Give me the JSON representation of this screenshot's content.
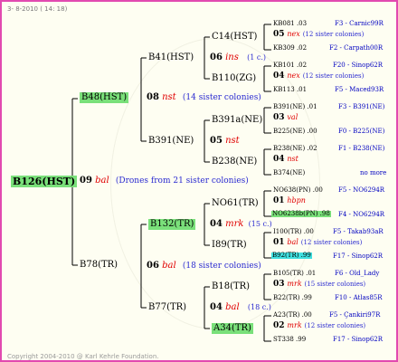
{
  "header": "3-  8-2010  ( 14: 18)",
  "footer": "Copyright 2004-2010 @ Karl Kehrle Foundation.",
  "gen1": {
    "name": "B126(HST)",
    "year": "09",
    "queen": "bal",
    "note": "(Drones from 21 sister colonies)"
  },
  "gen2a": {
    "name": "B48(HST)",
    "year": "08",
    "queen": "nst",
    "note": "(14 sister colonies)"
  },
  "gen2b": {
    "name": "B78(TR)",
    "year": "06",
    "queen": "bal",
    "note": "(18 sister colonies)"
  },
  "gen3": [
    {
      "name": "B41(HST)",
      "year": "06",
      "queen": "ins",
      "note": "(1 c.)"
    },
    {
      "name": "B391(NE)",
      "year": "05",
      "queen": "nst",
      "note": ""
    },
    {
      "name": "B132(TR)",
      "year": "04",
      "queen": "mrk",
      "note": "(15 c.)"
    },
    {
      "name": "B77(TR)",
      "year": "04",
      "queen": "bal",
      "note": "(18 c.)"
    }
  ],
  "gen4": [
    {
      "name": "C14(HST)"
    },
    {
      "name": "B110(ZG)"
    },
    {
      "name": "B391a(NE)"
    },
    {
      "name": "B238(NE)"
    },
    {
      "name": "NO61(TR)"
    },
    {
      "name": "I89(TR)"
    },
    {
      "name": "B18(TR)"
    },
    {
      "name": "A34(TR)"
    }
  ],
  "gen5": [
    {
      "l1": "KB081 .03",
      "r1": "F3 - Carnic99R",
      "yr": "05",
      "q": "nex",
      "n": "(12 sister colonies)",
      "l2": "KB309 .02",
      "r2": "F2 - Carpath00R"
    },
    {
      "l1": "KB101 .02",
      "r1": "F20 - Sinop62R",
      "yr": "04",
      "q": "nex",
      "n": "(12 sister colonies)",
      "l2": "KB113 .01",
      "r2": "F5 - Maced93R"
    },
    {
      "l1": "B391(NE) .01",
      "r1": "F3 - B391(NE)",
      "yr": "03",
      "q": "val",
      "n": "",
      "l2": "B225(NE) .00",
      "r2": "F0 - B225(NE)"
    },
    {
      "l1": "B238(NE) .02",
      "r1": "F1 - B238(NE)",
      "yr": "04",
      "q": "nst",
      "n": "",
      "l2": "B374(NE)",
      "r2": "no more"
    },
    {
      "l1": "NO638(PN) .00",
      "r1": "F5 - NO6294R",
      "yr": "01",
      "q": "hbpn",
      "n": "",
      "l2": "NO6238b(PN) .98",
      "r2": "F4 - NO6294R"
    },
    {
      "l1": "I100(TR) .00",
      "r1": "F5 - Takab93aR",
      "yr": "01",
      "q": "bal",
      "n": "(12 sister colonies)",
      "l2": "B92(TR) .99",
      "r2": "F17 - Sinop62R"
    },
    {
      "l1": "B105(TR) .01",
      "r1": "F6 - Old_Lady",
      "yr": "03",
      "q": "mrk",
      "n": "(15 sister colonies)",
      "l2": "B22(TR) .99",
      "r2": "F10 - Atlas85R"
    },
    {
      "l1": "A23(TR) .00",
      "r1": "F5 - Çankiri97R",
      "yr": "02",
      "q": "mrk",
      "n": "(12 sister colonies)",
      "l2": "ST338 .99",
      "r2": "F17 - Sinop62R"
    }
  ]
}
